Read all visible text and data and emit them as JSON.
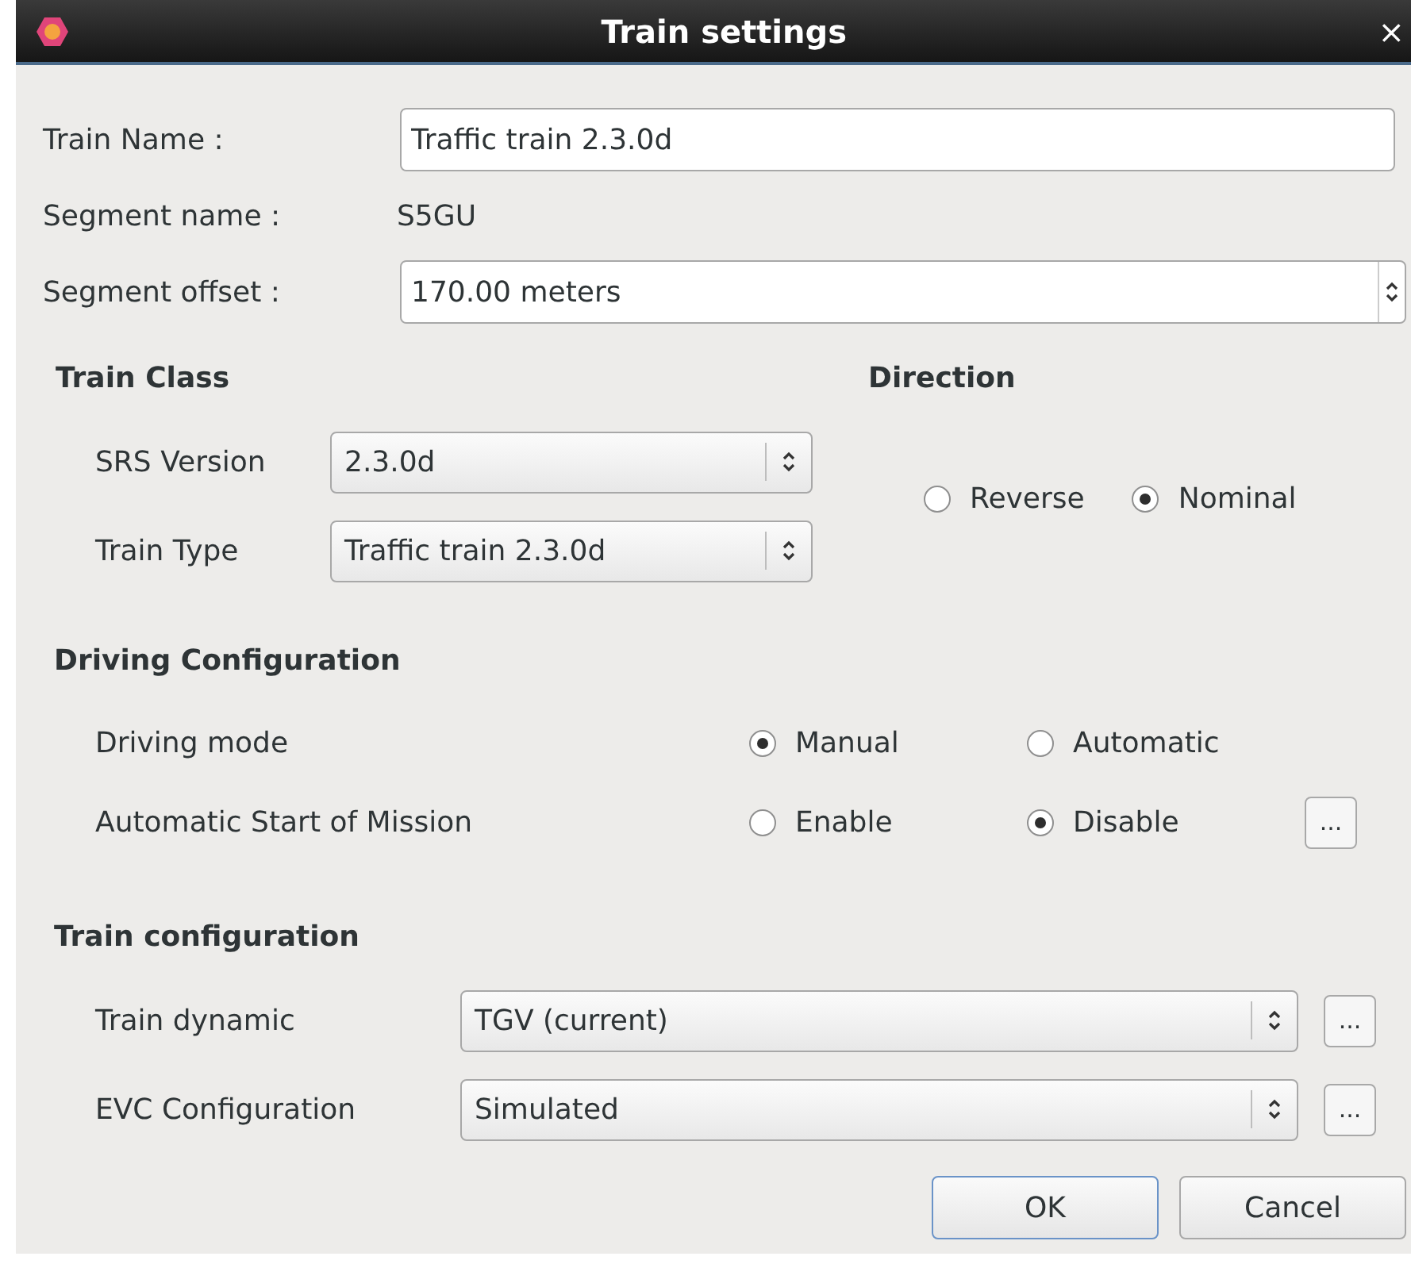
{
  "window": {
    "title": "Train settings",
    "close": "×"
  },
  "train_name": {
    "label": "Train Name :",
    "value": "Traffic train 2.3.0d"
  },
  "segment_name": {
    "label": "Segment name :",
    "value": "S5GU"
  },
  "segment_offset": {
    "label": "Segment offset :",
    "value": "170.00 meters"
  },
  "train_class": {
    "heading": "Train Class",
    "fields": [
      {
        "label": "SRS Version",
        "value": "2.3.0d"
      },
      {
        "label": "Train Type",
        "value": "Traffic train 2.3.0d"
      }
    ]
  },
  "direction": {
    "heading": "Direction",
    "options": [
      {
        "label": "Reverse",
        "selected": false
      },
      {
        "label": "Nominal",
        "selected": true
      }
    ]
  },
  "driving_configuration": {
    "heading": "Driving Configuration",
    "rows": [
      {
        "label": "Driving mode",
        "options": [
          {
            "label": "Manual",
            "selected": true
          },
          {
            "label": "Automatic",
            "selected": false
          }
        ]
      },
      {
        "label": "Automatic Start of Mission",
        "options": [
          {
            "label": "Enable",
            "selected": false
          },
          {
            "label": "Disable",
            "selected": true
          }
        ],
        "more": "..."
      }
    ]
  },
  "train_configuration": {
    "heading": "Train configuration",
    "rows": [
      {
        "label": "Train dynamic",
        "value": "TGV (current)",
        "more": "..."
      },
      {
        "label": "EVC Configuration",
        "value": "Simulated",
        "more": "..."
      }
    ]
  },
  "buttons": [
    {
      "label": "OK",
      "kind": "default"
    },
    {
      "label": "Cancel",
      "kind": "normal"
    }
  ]
}
